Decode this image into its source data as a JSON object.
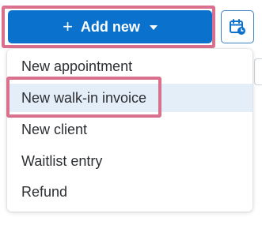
{
  "toolbar": {
    "add_new_label": "Add new",
    "add_new_icon": "plus-icon",
    "dropdown_icon": "caret-down-icon",
    "calendar_icon": "calendar-clock-icon"
  },
  "menu": {
    "items": [
      {
        "label": "New appointment",
        "active": false
      },
      {
        "label": "New walk-in invoice",
        "active": true
      },
      {
        "label": "New client",
        "active": false
      },
      {
        "label": "Waitlist entry",
        "active": false
      },
      {
        "label": "Refund",
        "active": false
      }
    ]
  },
  "colors": {
    "primary": "#0a72cc",
    "highlight_frame": "#d9708e",
    "active_item_bg": "#e4eef8",
    "text": "#2c2f33"
  }
}
